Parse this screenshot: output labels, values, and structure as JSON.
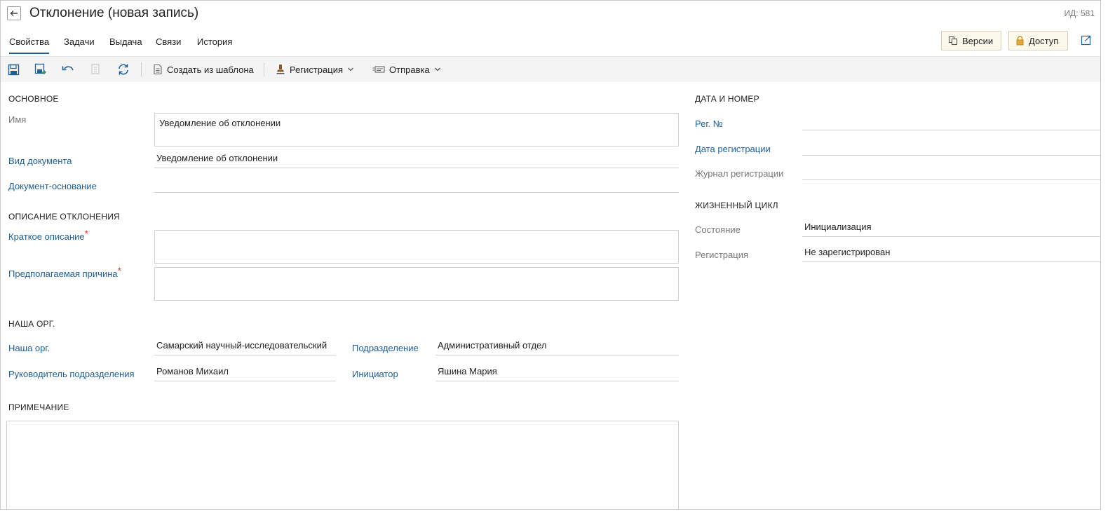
{
  "header": {
    "title": "Отклонение (новая запись)",
    "record_id": "ИД: 581",
    "tabs": [
      {
        "label": "Свойства",
        "active": true
      },
      {
        "label": "Задачи"
      },
      {
        "label": "Выдача"
      },
      {
        "label": "Связи"
      },
      {
        "label": "История"
      }
    ],
    "versions_label": "Версии",
    "access_label": "Доступ"
  },
  "toolbar": {
    "create_from_template": "Создать из шаблона",
    "registration": "Регистрация",
    "send": "Отправка"
  },
  "main": {
    "section_main": "ОСНОВНОЕ",
    "name_label": "Имя",
    "name_value": "Уведомление об отклонении",
    "doc_kind_label": "Вид документа",
    "doc_kind_value": "Уведомление об отклонении",
    "basis_label": "Документ-основание",
    "basis_value": "",
    "section_description": "ОПИСАНИЕ ОТКЛОНЕНИЯ",
    "short_desc_label": "Краткое описание",
    "short_desc_value": "",
    "reason_label": "Предполагаемая причина",
    "reason_value": "",
    "required_mark": "*",
    "section_org": "НАША ОРГ.",
    "org_label": "Наша орг.",
    "org_value": "Самарский научный-исследовательский",
    "department_label": "Подразделение",
    "department_value": "Административный отдел",
    "manager_label": "Руководитель подразделения",
    "manager_value": "Романов Михаил",
    "initiator_label": "Инициатор",
    "initiator_value": "Яшина Мария",
    "section_note": "ПРИМЕЧАНИЕ",
    "note_value": ""
  },
  "side": {
    "section_date": "ДАТА И НОМЕР",
    "reg_no_label": "Рег. №",
    "reg_no_value": "",
    "reg_date_label": "Дата регистрации",
    "reg_date_value": "",
    "reg_journal_label": "Журнал регистрации",
    "reg_journal_value": "",
    "section_lifecycle": "ЖИЗНЕННЫЙ ЦИКЛ",
    "state_label": "Состояние",
    "state_value": "Инициализация",
    "registration_label": "Регистрация",
    "registration_value": "Не зарегистрирован"
  },
  "colors": {
    "link": "#1f5f94",
    "required": "#e0402c",
    "toolbar_icon": "#1f5f94",
    "accent_button_bg": "#fbf8ec"
  },
  "icons": [
    "back-arrow-icon",
    "versions-icon",
    "lock-icon",
    "open-external-icon",
    "save-icon",
    "save-as-icon",
    "undo-icon",
    "copy-icon",
    "refresh-icon",
    "document-icon",
    "stamp-icon",
    "send-icon",
    "chevron-down-icon"
  ]
}
